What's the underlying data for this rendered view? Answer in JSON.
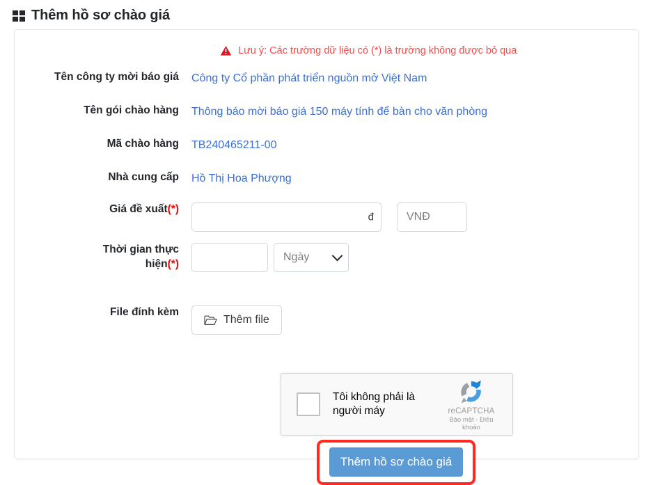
{
  "header": {
    "icon": "grid-icon",
    "title": "Thêm hồ sơ chào giá"
  },
  "notice": {
    "icon": "warning-triangle-icon",
    "text": "Lưu ý: Các trường dữ liệu có (*) là trường không được bỏ qua",
    "color": "#fb4a46"
  },
  "form": {
    "company": {
      "label": "Tên công ty mời báo giá",
      "value": "Công ty Cổ phần phát triển nguồn mở Việt Nam"
    },
    "package": {
      "label": "Tên gói chào hàng",
      "value": "Thông báo mời báo giá 150 máy tính để bàn cho văn phòng"
    },
    "code": {
      "label": "Mã chào hàng",
      "value": "TB240465211-00"
    },
    "supplier": {
      "label": "Nhà cung cấp",
      "value": "Hồ Thị Hoa Phượng"
    },
    "price": {
      "label": "Giá đề xuất",
      "required_mark": "(*)",
      "value": "",
      "placeholder": "",
      "suffix": "đ",
      "unit": "VNĐ"
    },
    "duration": {
      "label_line1": "Thời gian thực",
      "label_line2": "hiện",
      "required_mark": "(*)",
      "value": "",
      "placeholder": "",
      "unit_selected": "Ngày",
      "unit_options": [
        "Ngày"
      ]
    },
    "attachment": {
      "label": "File đính kèm",
      "button_label": "Thêm file",
      "button_icon": "folder-open-icon"
    }
  },
  "recaptcha": {
    "checkbox_label": "Tôi không phải là người máy",
    "brand": "reCAPTCHA",
    "terms": "Bảo mật - Điều khoản"
  },
  "submit": {
    "label": "Thêm hồ sơ chào giá",
    "color": "#5b9bd5",
    "highlight_color": "#ff2a22"
  }
}
